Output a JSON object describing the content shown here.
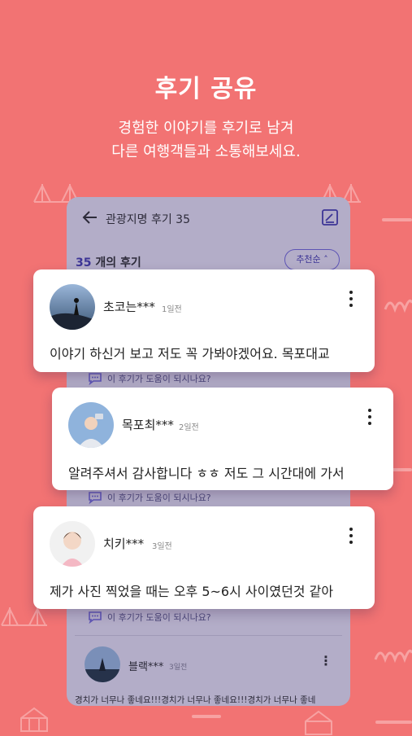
{
  "hero": {
    "title": "후기 공유",
    "subtitle_line1": "경험한 이야기를 후기로 남겨",
    "subtitle_line2": "다른 여행객들과 소통해보세요."
  },
  "phone": {
    "header_title": "관광지명 후기 35",
    "review_count": "35",
    "review_count_label": "개의 후기",
    "sort_label": "추천순",
    "helpful_label": "이 후기가 도움이 되시나요?",
    "inner_review": {
      "user": "블랙***",
      "time": "3일전",
      "text": "경치가 너무나 좋네요!!!경치가 너무나 좋네요!!!경치가 너무나 좋네"
    }
  },
  "cards": [
    {
      "user": "초코는***",
      "time": "1일전",
      "text": "이야기 하신거 보고 저도 꼭 가봐야겠어요. 목포대교"
    },
    {
      "user": "목포최***",
      "time": "2일전",
      "text": "알려주셔서 감사합니다 ㅎㅎ 저도 그 시간대에 가서"
    },
    {
      "user": "치키***",
      "time": "3일전",
      "text": "제가 사진 찍었을 때는 오후 5~6시 사이였던것 같아"
    }
  ],
  "colors": {
    "background": "#f27373",
    "accent": "#3d3596",
    "phone_bg": "#b3adc8"
  }
}
